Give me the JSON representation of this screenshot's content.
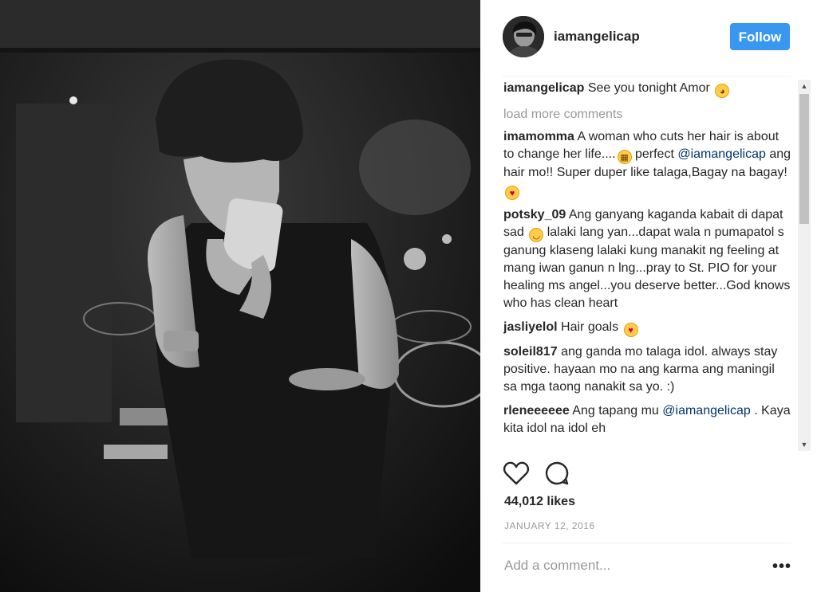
{
  "post": {
    "username": "iamangelicap",
    "follow_label": "Follow",
    "likes": "44,012 likes",
    "date": "JANUARY 12, 2016",
    "add_comment_placeholder": "Add a comment...",
    "more_label": "•••"
  },
  "caption": {
    "user": "iamangelicap",
    "text": "See you tonight Amor",
    "emoji": "smirk"
  },
  "load_more": "load more comments",
  "comments": [
    {
      "user": "imamomma",
      "text_a": "A woman who cuts her hair is about to change her life....",
      "emoji_a": "grimace",
      "text_b": " perfect ",
      "mention": "@iamangelicap",
      "text_c": " ang hair mo!! Super duper like talaga,Bagay na bagay! ",
      "emoji_c": "kiss"
    },
    {
      "user": "potsky_09",
      "text_a": "Ang ganyang kaganda kabait di dapat sad ",
      "emoji_a": "smile",
      "text_b": " lalaki lang yan...dapat wala n pumapatol s ganung klaseng lalaki kung manakit ng feeling at mang iwan ganun n lng...pray to St. PIO for your healing ms angel...you deserve better...God knows who has clean heart"
    },
    {
      "user": "jasliyelol",
      "text_a": "Hair goals ",
      "emoji_a": "heart-eyes"
    },
    {
      "user": "soleil817",
      "text_a": "ang ganda mo talaga idol. always stay positive. hayaan mo na ang karma ang maningil sa mga taong nanakit sa yo. :)"
    },
    {
      "user": "rleneeeeee",
      "text_a": "Ang tapang mu ",
      "mention": "@iamangelicap",
      "text_b": " . Kaya kita idol na idol eh"
    }
  ]
}
